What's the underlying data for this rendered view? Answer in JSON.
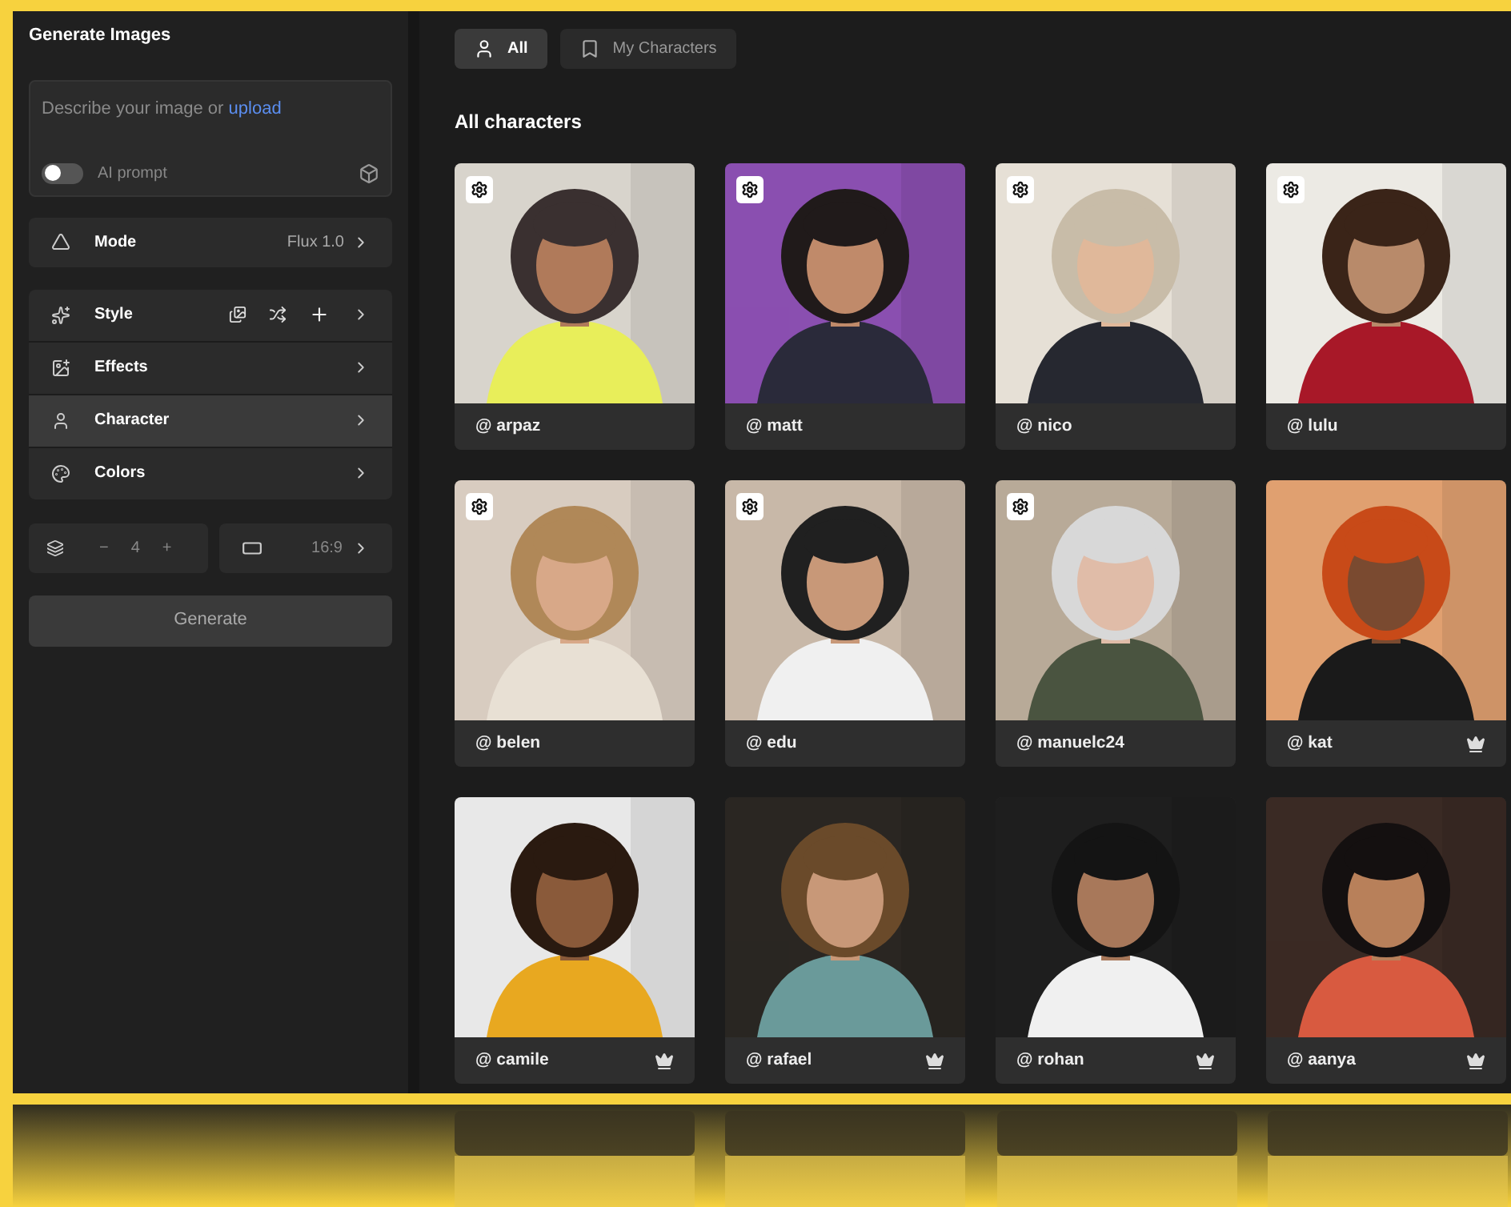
{
  "sidebar": {
    "title": "Generate Images",
    "prompt": {
      "placeholder": "Describe your image or",
      "link": "upload",
      "ai_prompt": {
        "label": "AI prompt",
        "on": false
      }
    },
    "mode": {
      "label": "Mode",
      "value": "Flux 1.0"
    },
    "options": [
      {
        "kind": "style",
        "label": "Style",
        "selected": false
      },
      {
        "kind": "effects",
        "label": "Effects",
        "selected": false
      },
      {
        "kind": "character",
        "label": "Character",
        "selected": true
      },
      {
        "kind": "colors",
        "label": "Colors",
        "selected": false
      }
    ],
    "count": {
      "minus": "−",
      "value": "4",
      "plus": "+"
    },
    "ratio": {
      "value": "16:9"
    },
    "generate": "Generate"
  },
  "tabs": [
    {
      "kind": "all",
      "label": "All",
      "selected": true
    },
    {
      "kind": "mine",
      "label": "My Characters",
      "selected": false
    }
  ],
  "section_title": "All characters",
  "characters": [
    {
      "handle": "@ arpaz",
      "custom": true,
      "premium": false
    },
    {
      "handle": "@ matt",
      "custom": true,
      "premium": false
    },
    {
      "handle": "@ nico",
      "custom": true,
      "premium": false
    },
    {
      "handle": "@ lulu",
      "custom": true,
      "premium": false
    },
    {
      "handle": "@ belen",
      "custom": true,
      "premium": false
    },
    {
      "handle": "@ edu",
      "custom": true,
      "premium": false
    },
    {
      "handle": "@ manuelc24",
      "custom": true,
      "premium": false
    },
    {
      "handle": "@ kat",
      "custom": false,
      "premium": true
    },
    {
      "handle": "@ camile",
      "custom": false,
      "premium": true
    },
    {
      "handle": "@ rafael",
      "custom": false,
      "premium": true
    },
    {
      "handle": "@ rohan",
      "custom": false,
      "premium": true
    },
    {
      "handle": "@ aanya",
      "custom": false,
      "premium": true
    }
  ]
}
